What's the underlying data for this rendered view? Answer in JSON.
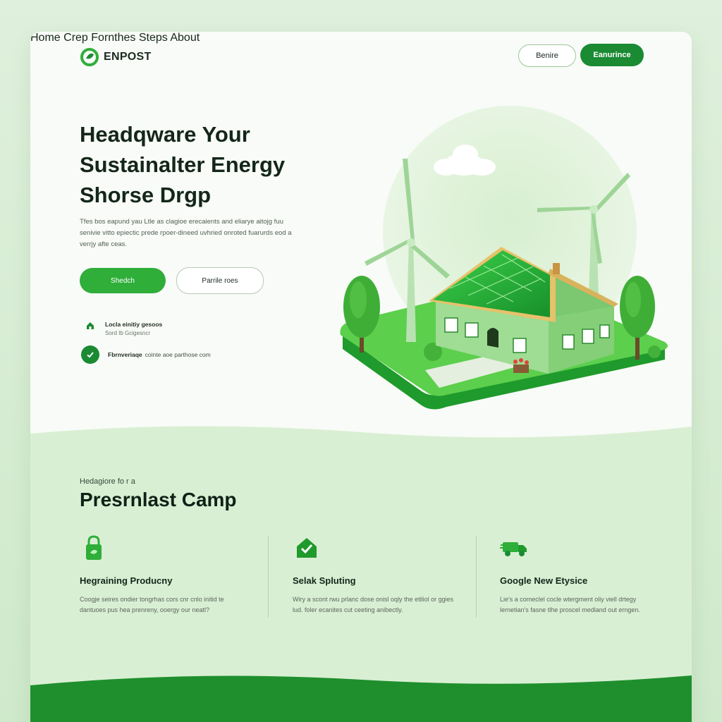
{
  "brand": {
    "name": "ENPOST"
  },
  "nav": {
    "links": [
      "Home",
      "Crep Fornthes",
      "Steps",
      "About"
    ],
    "secondary_button": "Benire",
    "primary_button": "Eanurince"
  },
  "hero": {
    "title_lines": [
      "Headqware Your",
      "Sustainalter Energy",
      "Shorse Drgp"
    ],
    "description": "Tfes bos eapund yau Ltle as clagioe erecaients and eliarye aitojg fuu senivie vitto epiectic prede rpoer-dineed uvhried onroted fuarurds eod a verrjy afte ceas.",
    "primary_button": "Shedch",
    "secondary_button": "Parrile roes",
    "features": [
      {
        "title": "Locla einitiy gesoos",
        "subtitle": "Sord Ib Gcigesncr"
      },
      {
        "title": "Fbrnveriaqe",
        "subtitle": "cointe aoe parthose com"
      }
    ]
  },
  "section": {
    "kicker": "Hedagiore fo r a",
    "title": "Presrnlast Camp",
    "columns": [
      {
        "icon": "lock-icon",
        "title": "Hegraining Producny",
        "desc": "Coogje seires ondier tongrhas cors cnr cnlo initid te dantuoes pus hea prenreny, ooergy our neatl?"
      },
      {
        "icon": "house-check-icon",
        "title": "Selak Spluting",
        "desc": "Wiry a scont rwu prlanc dose onisl oqly the etiliol or ggies lud. foler ecanites cut ceeting anibectly."
      },
      {
        "icon": "truck-icon",
        "title": "Google New Etysice",
        "desc": "Lie's a comeclel cocle wtergment oliy viell drtegy lernetian's fasne tlhe proscel medland out erngen."
      }
    ]
  },
  "colors": {
    "primary": "#1a8a33",
    "accent": "#2fae3a",
    "soft": "#d9efd3"
  }
}
